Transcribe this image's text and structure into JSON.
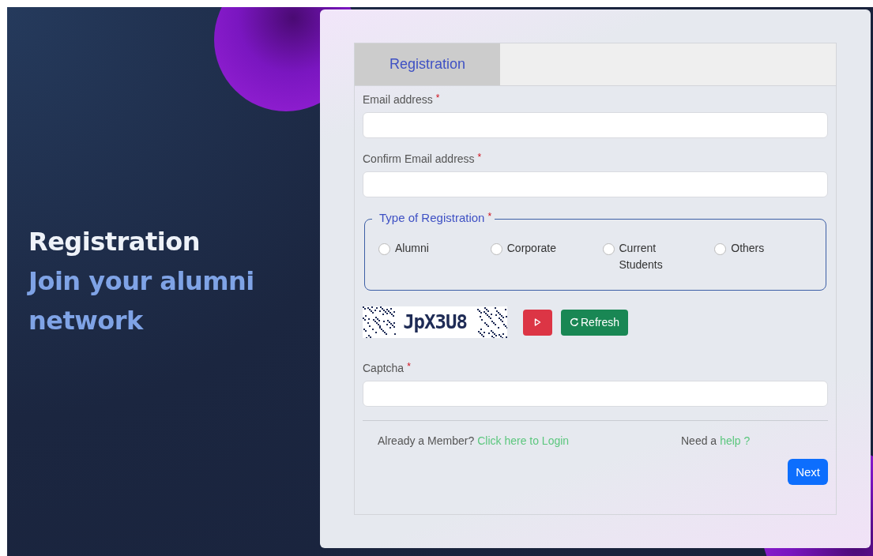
{
  "hero": {
    "title": "Registration",
    "subtitle": "Join your alumni network"
  },
  "tabs": [
    {
      "label": "Registration",
      "selected": true
    }
  ],
  "fields": [
    {
      "label": "Email address",
      "required_mark": "*"
    },
    {
      "label": "Confirm Email address",
      "required_mark": "*"
    }
  ],
  "registration_type": {
    "legend": "Type of Registration",
    "required_mark": "*",
    "options": [
      {
        "label": "Alumni",
        "selected": false
      },
      {
        "label": "Corporate",
        "selected": false
      },
      {
        "label": "Current Students",
        "selected": false
      },
      {
        "label": "Others",
        "selected": false
      }
    ]
  },
  "captcha": {
    "code": "JpX3U8",
    "refresh_label": "Refresh",
    "field": {
      "label": "Captcha",
      "required_mark": "*"
    }
  },
  "login_prompt": {
    "text": "Already a Member?",
    "link": "Click here to Login"
  },
  "help_prompt": {
    "text": "Need a",
    "link": "help ?"
  },
  "next_button": "Next"
}
